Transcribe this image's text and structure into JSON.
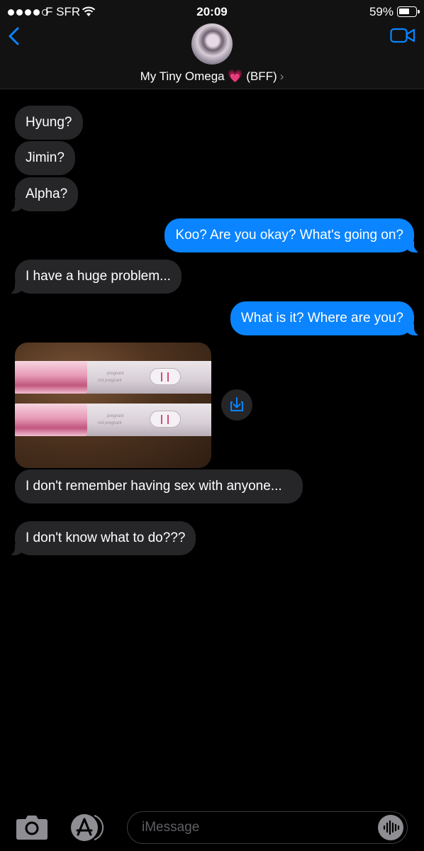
{
  "status_bar": {
    "carrier": "F SFR",
    "time": "20:09",
    "battery": "59%"
  },
  "header": {
    "contact_name": "My Tiny Omega",
    "contact_emoji": "💗",
    "contact_tag": "(BFF)",
    "chevron": "›",
    "icons": [
      "back-chevron-icon",
      "video-camera-icon"
    ]
  },
  "messages": [
    {
      "side": "incoming",
      "text": "Hyung?"
    },
    {
      "side": "incoming",
      "text": "Jimin?"
    },
    {
      "side": "incoming",
      "text": "Alpha?"
    },
    {
      "side": "outgoing",
      "text": "Koo? Are you okay? What's going on?"
    },
    {
      "side": "incoming",
      "text": "I have a huge problem..."
    },
    {
      "side": "outgoing",
      "text": "What is it? Where are you?"
    },
    {
      "side": "incoming",
      "type": "image",
      "label_pregnant": "pregnant",
      "label_not_pregnant": "not pregnant"
    },
    {
      "side": "incoming",
      "text": "I don't remember having sex with anyone..."
    },
    {
      "side": "incoming",
      "text": "I don't know what to do???"
    }
  ],
  "composer": {
    "placeholder": "iMessage",
    "icons": [
      "camera-icon",
      "app-store-icon",
      "audio-waveform-icon"
    ]
  },
  "colors": {
    "outgoing_bubble": "#0a84ff",
    "incoming_bubble": "#262628",
    "background": "#000000",
    "header": "#121212"
  }
}
